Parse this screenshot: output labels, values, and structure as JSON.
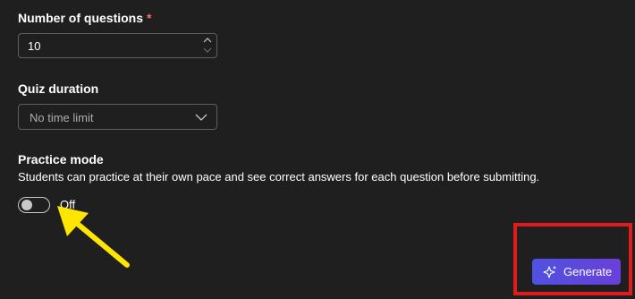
{
  "number_of_questions": {
    "label": "Number of questions",
    "required_marker": "*",
    "value": "10"
  },
  "quiz_duration": {
    "label": "Quiz duration",
    "selected": "No time limit"
  },
  "practice_mode": {
    "label": "Practice mode",
    "description": "Students can practice at their own pace and see correct answers for each question before submitting.",
    "enabled": false,
    "state_label": "Off"
  },
  "generate_button": {
    "label": "Generate",
    "icon": "sparkle-icon"
  },
  "annotations": {
    "arrow_color": "#ffe600",
    "highlight_color": "#e01b1b"
  },
  "colors": {
    "background": "#1f1f1f",
    "accent": "#5b4ce0",
    "required": "#ff6b6b"
  }
}
